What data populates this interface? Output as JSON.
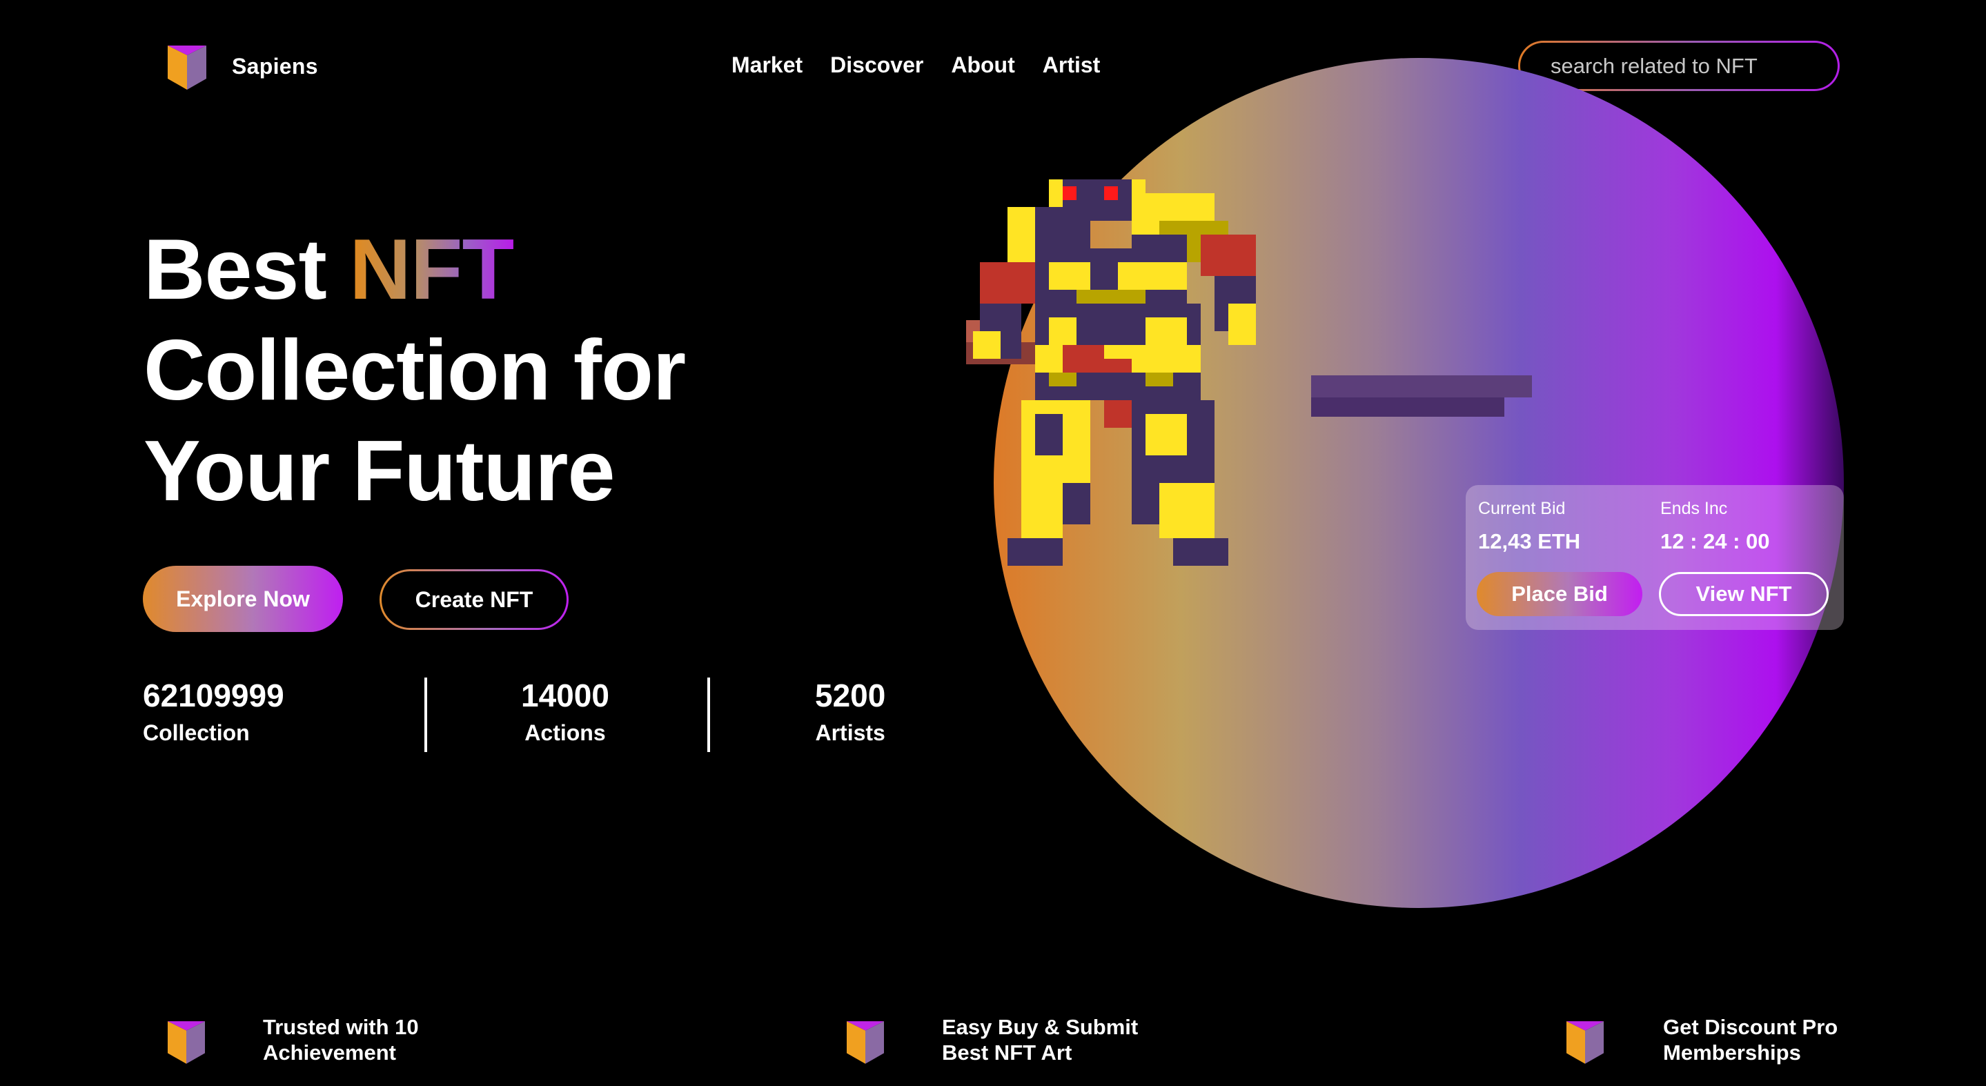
{
  "brand": {
    "name": "Sapiens"
  },
  "nav": {
    "items": [
      "Market",
      "Discover",
      "About",
      "Artist"
    ]
  },
  "search": {
    "placeholder": "search related to NFT"
  },
  "hero": {
    "title_word_1": "Best",
    "title_accent": "NFT",
    "title_line_2": "Collection for",
    "title_line_3": "Your Future",
    "explore_label": "Explore Now",
    "create_label": "Create NFT"
  },
  "stats": [
    {
      "value": "62109999",
      "label": "Collection"
    },
    {
      "value": "14000",
      "label": "Actions"
    },
    {
      "value": "5200",
      "label": "Artists"
    }
  ],
  "bid_card": {
    "current_bid_label": "Current Bid",
    "current_bid_value": "12,43 ETH",
    "ends_label": "Ends Inc",
    "ends_value": "12 : 24 : 00",
    "place_bid_label": "Place Bid",
    "view_nft_label": "View NFT"
  },
  "features": [
    {
      "line1": "Trusted with 10",
      "line2": "Achievement"
    },
    {
      "line1": "Easy Buy & Submit",
      "line2": "Best NFT Art"
    },
    {
      "line1": "Get Discount Pro",
      "line2": "Memberships"
    }
  ],
  "colors": {
    "background": "#000000",
    "accent_orange": "#e08a2c",
    "accent_purple": "#bf1ff0",
    "creature_yellow": "#ffe424",
    "creature_purple": "#3f2f5f",
    "creature_red": "#c0342a"
  },
  "icons": {
    "logo": "cube-logo-icon"
  }
}
